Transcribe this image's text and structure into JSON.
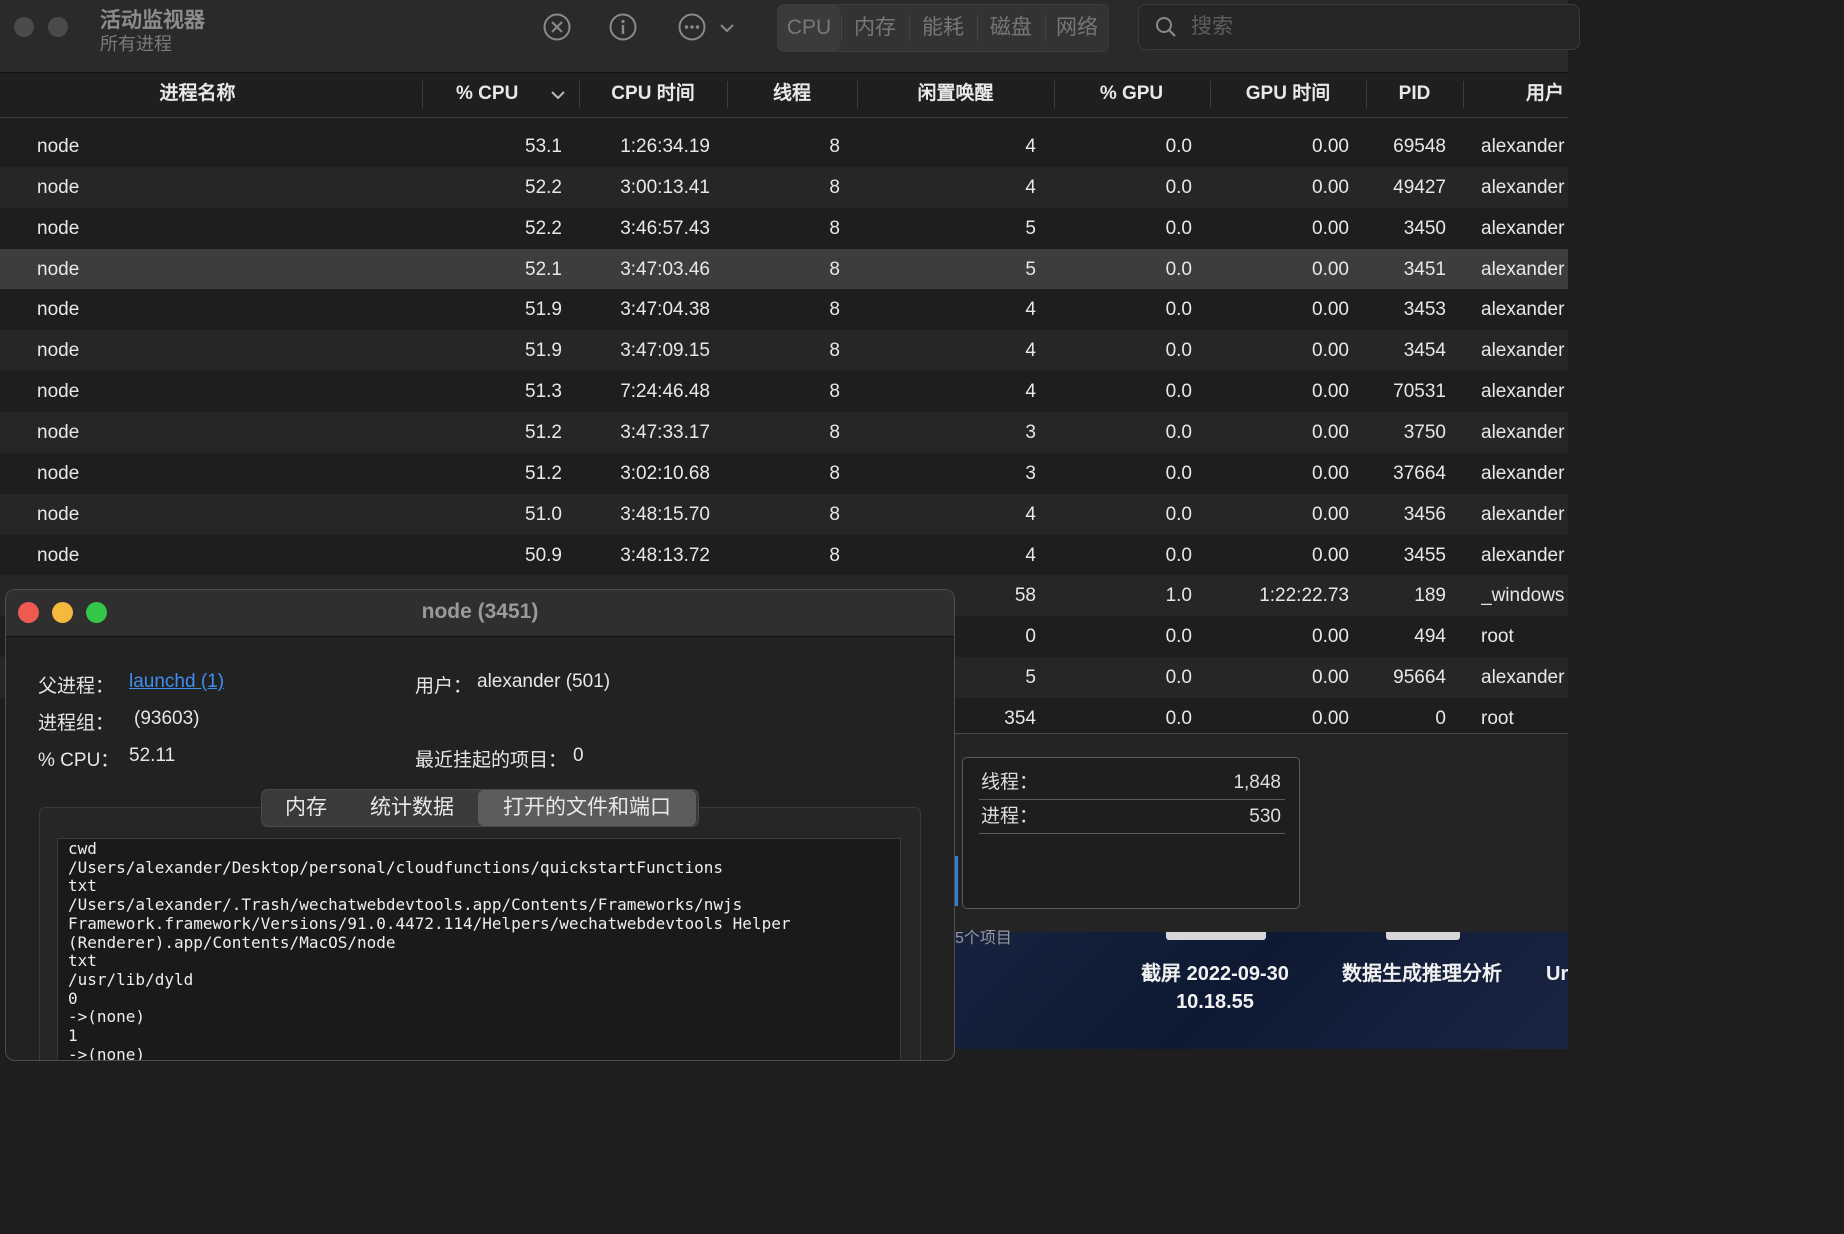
{
  "app": {
    "title": "活动监视器",
    "subtitle": "所有进程"
  },
  "toolbar": {
    "icons": [
      "stop-icon",
      "info-icon",
      "more-icon",
      "chevron-down-icon"
    ],
    "tabs": [
      "CPU",
      "内存",
      "能耗",
      "磁盘",
      "网络"
    ],
    "active_tab": "CPU",
    "search_placeholder": "搜索"
  },
  "table": {
    "columns": [
      "进程名称",
      "% CPU",
      "CPU 时间",
      "线程",
      "闲置唤醒",
      "% GPU",
      "GPU 时间",
      "PID",
      "用户"
    ],
    "sort_column": "% CPU",
    "rows": [
      [
        "node",
        "53.1",
        "1:26:34.19",
        "8",
        "4",
        "0.0",
        "0.00",
        "69548",
        "alexander"
      ],
      [
        "node",
        "52.2",
        "3:00:13.41",
        "8",
        "4",
        "0.0",
        "0.00",
        "49427",
        "alexander"
      ],
      [
        "node",
        "52.2",
        "3:46:57.43",
        "8",
        "5",
        "0.0",
        "0.00",
        "3450",
        "alexander"
      ],
      [
        "node",
        "52.1",
        "3:47:03.46",
        "8",
        "5",
        "0.0",
        "0.00",
        "3451",
        "alexander"
      ],
      [
        "node",
        "51.9",
        "3:47:04.38",
        "8",
        "4",
        "0.0",
        "0.00",
        "3453",
        "alexander"
      ],
      [
        "node",
        "51.9",
        "3:47:09.15",
        "8",
        "4",
        "0.0",
        "0.00",
        "3454",
        "alexander"
      ],
      [
        "node",
        "51.3",
        "7:24:46.48",
        "8",
        "4",
        "0.0",
        "0.00",
        "70531",
        "alexander"
      ],
      [
        "node",
        "51.2",
        "3:47:33.17",
        "8",
        "3",
        "0.0",
        "0.00",
        "3750",
        "alexander"
      ],
      [
        "node",
        "51.2",
        "3:02:10.68",
        "8",
        "3",
        "0.0",
        "0.00",
        "37664",
        "alexander"
      ],
      [
        "node",
        "51.0",
        "3:48:15.70",
        "8",
        "4",
        "0.0",
        "0.00",
        "3456",
        "alexander"
      ],
      [
        "node",
        "50.9",
        "3:48:13.72",
        "8",
        "4",
        "0.0",
        "0.00",
        "3455",
        "alexander"
      ],
      [
        "",
        "",
        "",
        "",
        "58",
        "1.0",
        "1:22:22.73",
        "189",
        "_windows"
      ],
      [
        "",
        "",
        "",
        "",
        "0",
        "0.0",
        "0.00",
        "494",
        "root"
      ],
      [
        "",
        "",
        "",
        "",
        "5",
        "0.0",
        "0.00",
        "95664",
        "alexander"
      ],
      [
        "",
        "",
        "",
        "",
        "354",
        "0.0",
        "0.00",
        "0",
        "root"
      ]
    ],
    "selected_row": 3
  },
  "summary": {
    "threads_label": "线程：",
    "threads_value": "1,848",
    "processes_label": "进程：",
    "processes_value": "530"
  },
  "desktop": {
    "items_count": "5个项目",
    "files": [
      {
        "name": "截屏 2022-09-30\n10.18.55"
      },
      {
        "name": "数据生成推理分析"
      },
      {
        "name": "Ur"
      }
    ]
  },
  "info_window": {
    "title": "node (3451)",
    "parent_label": "父进程：",
    "parent_value": "launchd (1)",
    "user_label": "用户：",
    "user_value": "alexander (501)",
    "group_label": "进程组：",
    "group_value": "(93603)",
    "cpu_label": "% CPU：",
    "cpu_value": "52.11",
    "recent_label": "最近挂起的项目：",
    "recent_value": "0",
    "tabs": [
      "内存",
      "统计数据",
      "打开的文件和端口"
    ],
    "active_tab": "打开的文件和端口",
    "files_lines": [
      "cwd",
      "/Users/alexander/Desktop/personal/cloudfunctions/quickstartFunctions",
      "txt",
      "/Users/alexander/.Trash/wechatwebdevtools.app/Contents/Frameworks/nwjs",
      "Framework.framework/Versions/91.0.4472.114/Helpers/wechatwebdevtools Helper",
      "(Renderer).app/Contents/MacOS/node",
      "txt",
      "/usr/lib/dyld",
      "0",
      "->(none)",
      "1",
      "->(none)"
    ]
  }
}
